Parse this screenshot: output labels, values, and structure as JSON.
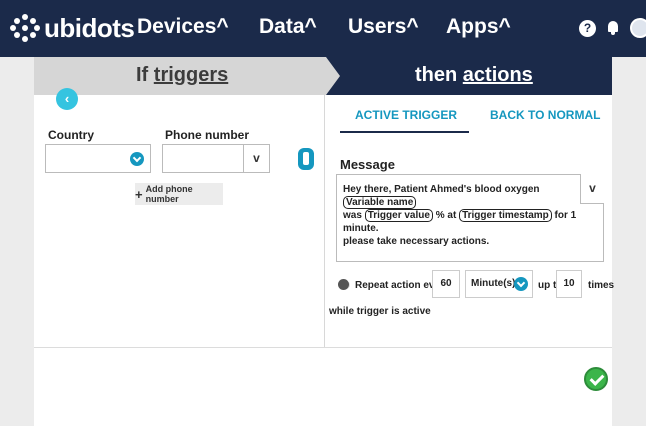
{
  "app": {
    "logo_text": "ubidots"
  },
  "nav": {
    "devices": "Devices^",
    "data": "Data^",
    "users": "Users^",
    "apps": "Apps^",
    "help_icon": "?"
  },
  "steps": {
    "if_prefix": "If ",
    "if_word": "triggers",
    "then_prefix": "then ",
    "then_word": "actions"
  },
  "form": {
    "country_label": "Country",
    "phone_label": "Phone number",
    "country_value": "",
    "phone_value": "",
    "add_phone_label": "Add phone number",
    "add_phone_icon": "+",
    "phone_chevron": "v"
  },
  "tabs": {
    "active_trigger": "ACTIVE TRIGGER",
    "back_to_normal": "BACK TO NORMAL"
  },
  "message": {
    "label": "Message",
    "line1_text": "Hey there, Patient Ahmed's blood oxygen",
    "token_variable_name": "Variable name",
    "line2_was": "was",
    "token_trigger_value": "Trigger value",
    "line2_mid": "% at",
    "token_trigger_timestamp": "Trigger timestamp",
    "line2_end": "for 1 minute.",
    "line3": "please take necessary actions.",
    "chevron": "v"
  },
  "repeat": {
    "label": "Repeat action every",
    "interval_value": "60",
    "unit": "Minute(s)",
    "up_to": "up to",
    "times_value": "10",
    "times": "times",
    "while_active": "while trigger is active"
  },
  "colors": {
    "nav_bg": "#1b2a4a",
    "accent": "#1597bf",
    "confirm": "#3bb54a"
  }
}
